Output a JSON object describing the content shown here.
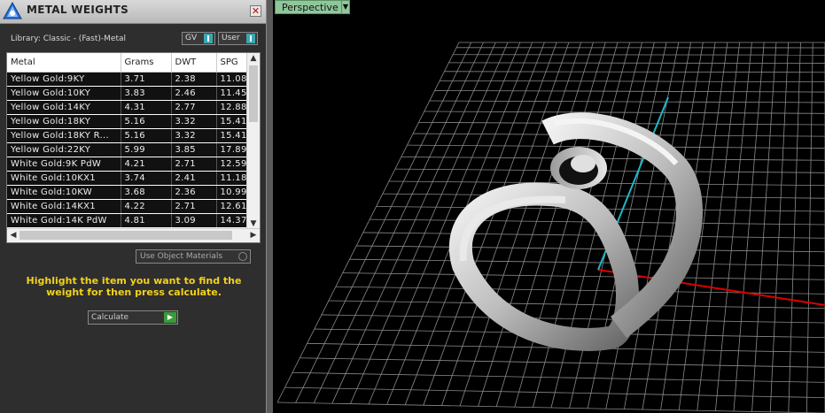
{
  "panel": {
    "title": "METAL WEIGHTS",
    "close_label": "✕",
    "library_label": "Library: Classic - (Fast)-Metal",
    "gv_label": "GV",
    "user_label": "User",
    "table": {
      "columns": [
        "Metal",
        "Grams",
        "DWT",
        "SPG"
      ],
      "rows": [
        [
          "Yellow Gold:9KY",
          "3.71",
          "2.38",
          "11.08"
        ],
        [
          "Yellow Gold:10KY",
          "3.83",
          "2.46",
          "11.45"
        ],
        [
          "Yellow Gold:14KY",
          "4.31",
          "2.77",
          "12.88"
        ],
        [
          "Yellow Gold:18KY",
          "5.16",
          "3.32",
          "15.41"
        ],
        [
          "Yellow Gold:18KY R...",
          "5.16",
          "3.32",
          "15.41"
        ],
        [
          "Yellow Gold:22KY",
          "5.99",
          "3.85",
          "17.89"
        ],
        [
          "White Gold:9K PdW",
          "4.21",
          "2.71",
          "12.59"
        ],
        [
          "White Gold:10KX1",
          "3.74",
          "2.41",
          "11.18"
        ],
        [
          "White Gold:10KW",
          "3.68",
          "2.36",
          "10.99"
        ],
        [
          "White Gold:14KX1",
          "4.22",
          "2.71",
          "12.61"
        ],
        [
          "White Gold:14K PdW",
          "4.81",
          "3.09",
          "14.37"
        ]
      ]
    },
    "use_object_materials_label": "Use Object Materials",
    "hint_text": "Highlight the item you want to find the weight for then press calculate.",
    "calculate_label": "Calculate"
  },
  "viewport": {
    "view_label": "Perspective"
  }
}
